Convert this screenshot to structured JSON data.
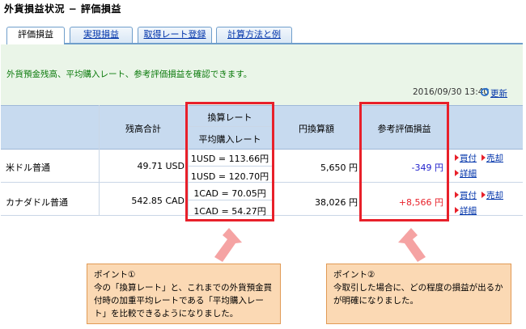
{
  "page_title": "外貨損益状況 − 評価損益",
  "tabs": [
    {
      "label": "評価損益",
      "active": true
    },
    {
      "label": "実現損益",
      "active": false
    },
    {
      "label": "取得レート登録",
      "active": false
    },
    {
      "label": "計算方法と例",
      "active": false
    }
  ],
  "intro": "外貨預金残高、平均購入レート、参考評価損益を確認できます。",
  "timestamp": "2016/09/30 13:40",
  "refresh_label": "更新",
  "headers": {
    "balance": "残高合計",
    "rate": "換算レート",
    "avg_rate": "平均購入レート",
    "yen_amount": "円換算額",
    "pl": "参考評価損益"
  },
  "rows": [
    {
      "name": "米ドル普通",
      "balance": "49.71 USD",
      "rate": "1USD = 113.66円",
      "avg_rate": "1USD = 120.70円",
      "yen_amount": "5,650 円",
      "pl": "-349 円",
      "pl_sign": "neg"
    },
    {
      "name": "カナダドル普通",
      "balance": "542.85 CAD",
      "rate": "1CAD = 70.05円",
      "avg_rate": "1CAD = 54.27円",
      "yen_amount": "38,026 円",
      "pl": "+8,566 円",
      "pl_sign": "pos"
    }
  ],
  "actions": {
    "buy": "買付",
    "sell": "売却",
    "detail": "詳細"
  },
  "callouts": [
    {
      "title": "ポイント①",
      "body": "今の「換算レート」と、これまでの外貨預金買付時の加重平均レートである「平均購入レート」を比較できるようになりました。"
    },
    {
      "title": "ポイント②",
      "body": "今取引した場合に、どの程度の損益が出るかが明確になりました。"
    }
  ],
  "colors": {
    "highlight": "#e8202a",
    "header_bg": "#c7daef",
    "panel_bg": "#eaf5e8",
    "callout_bg": "#fbd9b4",
    "arrow": "#f5a3a3"
  }
}
